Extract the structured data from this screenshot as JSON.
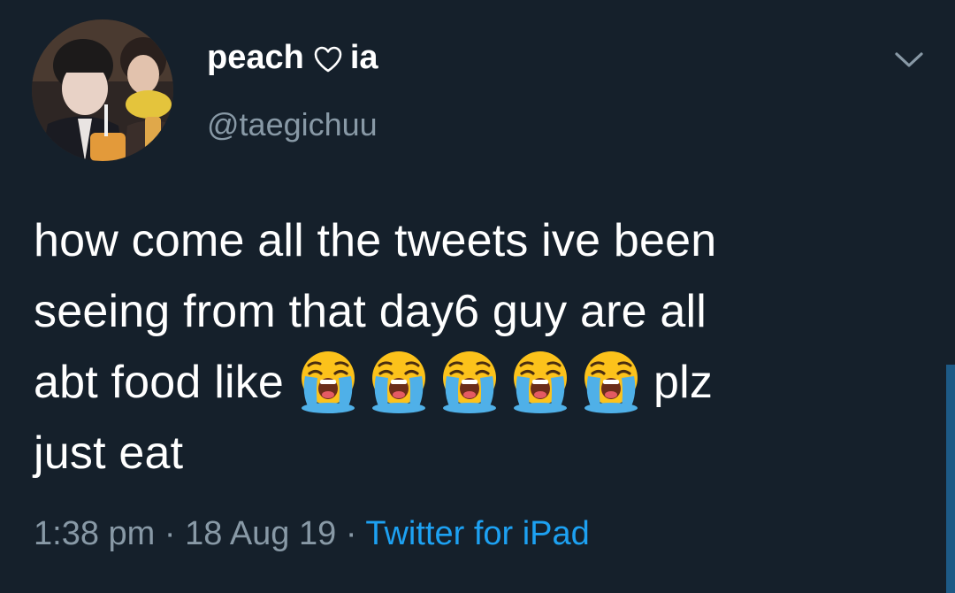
{
  "tweet": {
    "display_name_prefix": "peach",
    "display_name_suffix": "ia",
    "handle": "@taegichuu",
    "text_lines": [
      "how come all the tweets ive been",
      "seeing from that day6 guy are all",
      "abt food like",
      "plz",
      "just eat"
    ],
    "emoji_count": 5,
    "emoji_name": "loudly-crying-face-emoji",
    "time": "1:38 pm",
    "separator": "·",
    "date": "18 Aug 19",
    "source": "Twitter for iPad"
  },
  "icons": {
    "heart": "heart-outline-icon",
    "menu": "chevron-down-icon"
  },
  "colors": {
    "background": "#15202b",
    "text": "#ffffff",
    "secondary": "#8899a6",
    "link": "#1da1f2"
  }
}
